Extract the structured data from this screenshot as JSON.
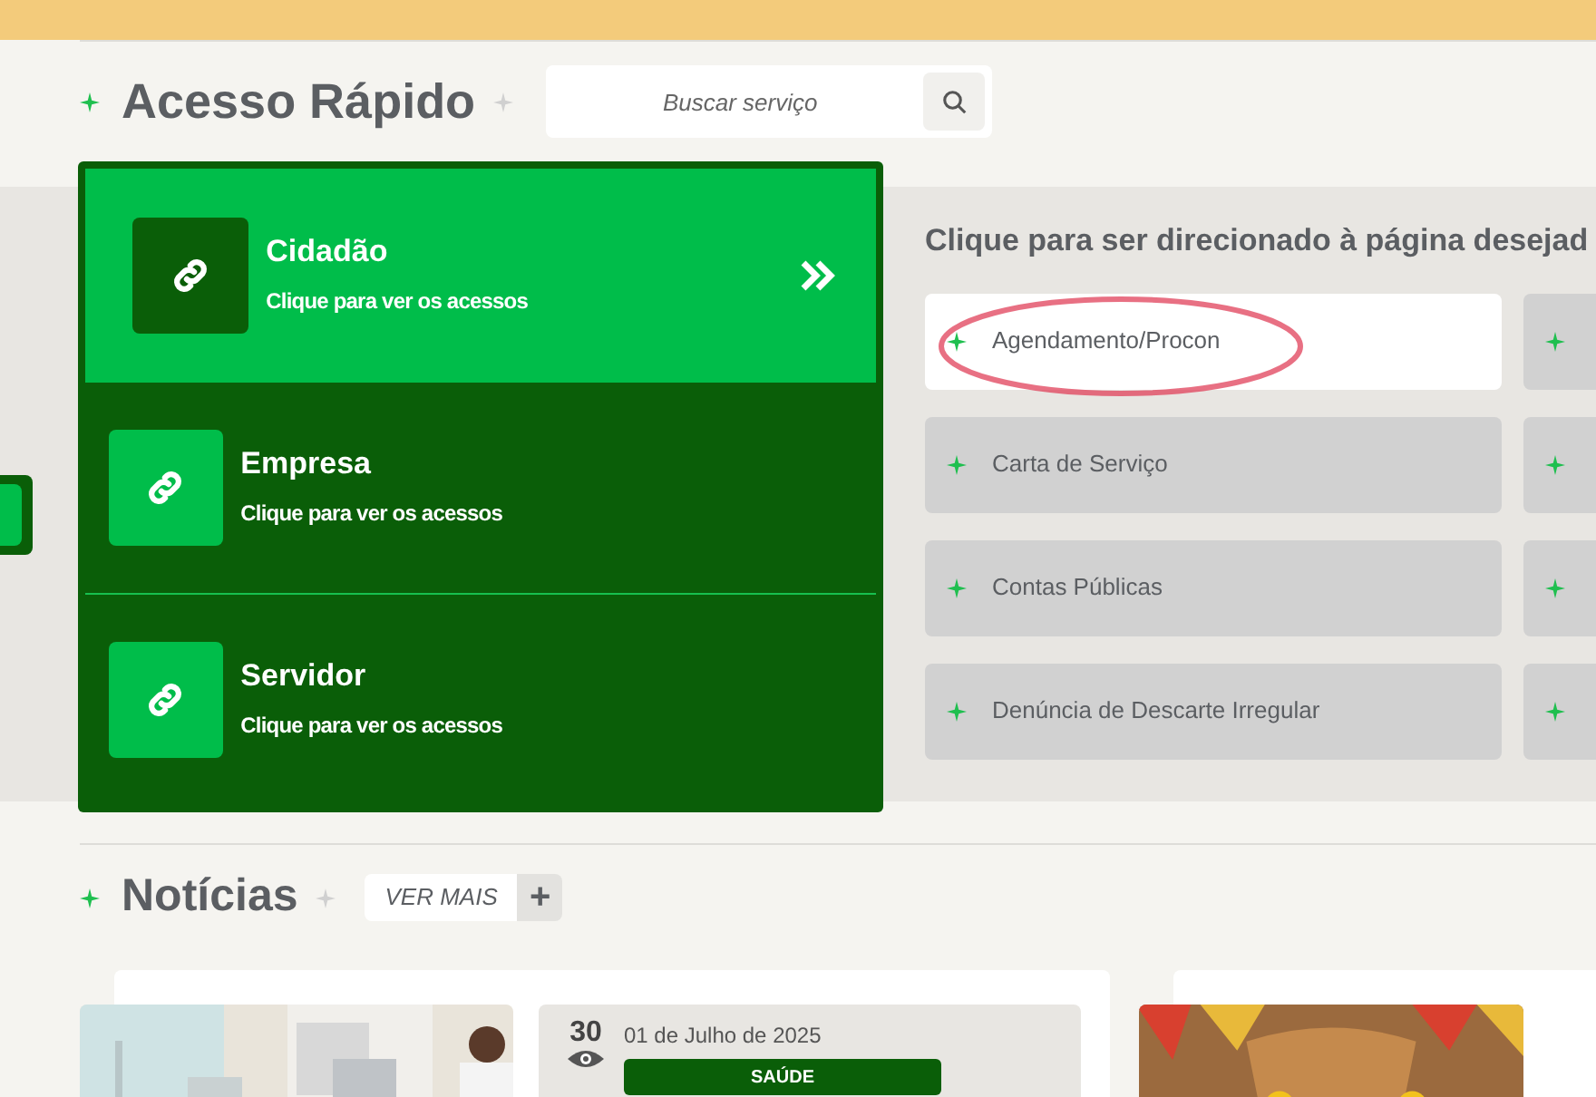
{
  "quick_access": {
    "title": "Acesso Rápido",
    "search": {
      "placeholder": "Buscar serviço"
    },
    "categories": [
      {
        "name": "Cidadão",
        "subtitle": "Clique para ver os acessos",
        "selected": true
      },
      {
        "name": "Empresa",
        "subtitle": "Clique para ver os acessos",
        "selected": false
      },
      {
        "name": "Servidor",
        "subtitle": "Clique para ver os acessos",
        "selected": false
      }
    ],
    "services_heading": "Clique para ser direcionado à página desejad",
    "services": [
      {
        "label": "Agendamento/Procon",
        "selected": true,
        "circled": true
      },
      {
        "label": "Carta de Serviço",
        "selected": false,
        "circled": false
      },
      {
        "label": "Contas Públicas",
        "selected": false,
        "circled": false
      },
      {
        "label": "Denúncia de Descarte Irregular",
        "selected": false,
        "circled": false
      }
    ]
  },
  "news": {
    "title": "Notícias",
    "more_button": "VER MAIS",
    "more_icon": "+",
    "items": [
      {
        "views": "30",
        "date": "01 de Julho de 2025",
        "tag": "SAÚDE"
      }
    ]
  }
}
